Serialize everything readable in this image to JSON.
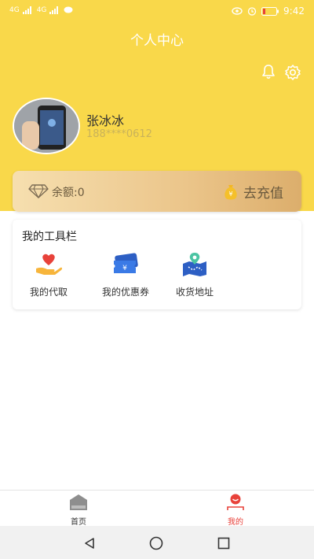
{
  "status_bar": {
    "left_items": [
      "4G",
      "4G"
    ],
    "time": "9:42"
  },
  "header": {
    "title": "个人中心"
  },
  "user": {
    "name": "张冰冰",
    "phone": "188****0612"
  },
  "balance": {
    "label": "余额:0",
    "recharge_label": "去充值"
  },
  "toolbar": {
    "title": "我的工具栏",
    "items": [
      {
        "label": "我的代取",
        "icon": "heart-hand-icon"
      },
      {
        "label": "我的优惠券",
        "icon": "coupon-icon"
      },
      {
        "label": "收货地址",
        "icon": "map-pin-icon"
      }
    ]
  },
  "bottom_nav": {
    "items": [
      {
        "label": "首页",
        "icon": "home-icon",
        "active": false
      },
      {
        "label": "我的",
        "icon": "profile-smile-icon",
        "active": true
      }
    ]
  },
  "colors": {
    "header_yellow": "#f9d84a",
    "accent_red": "#e8423a"
  }
}
